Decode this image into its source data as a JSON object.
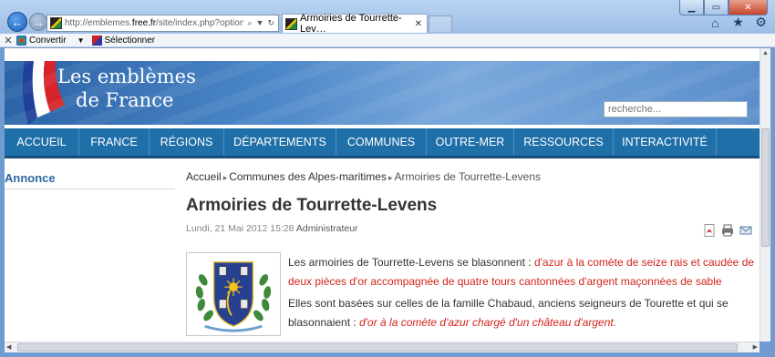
{
  "browser": {
    "address_url_prefix": "http://emblemes.",
    "address_url_domain": "free.fr",
    "address_url_rest": "/site/index.php?option=com_conten",
    "tab_title": "Armoiries de Tourrette-Lev…",
    "tab_close": "✕",
    "command_bar": {
      "close": "✕",
      "convert_label": "Convertir",
      "select_label": "Sélectionner"
    }
  },
  "site": {
    "title_line1": "Les emblèmes",
    "title_line2": "de France",
    "search_placeholder": "recherche...",
    "nav": [
      {
        "label": "ACCUEIL"
      },
      {
        "label": "FRANCE"
      },
      {
        "label": "RÉGIONS"
      },
      {
        "label": "DÉPARTEMENTS"
      },
      {
        "label": "COMMUNES"
      },
      {
        "label": "OUTRE-MER"
      },
      {
        "label": "RESSOURCES"
      },
      {
        "label": "INTERACTIVITÉ"
      }
    ],
    "sidebar_heading": "Annonce"
  },
  "article": {
    "breadcrumb": [
      "Accueil",
      "Communes des Alpes-maritimes",
      "Armoiries de Tourrette-Levens"
    ],
    "title": "Armoiries de Tourrette-Levens",
    "date": "Lundi, 21 Mai 2012 15:28",
    "author": "Administrateur",
    "p1_plain": "Les armoiries de Tourrette-Levens se blasonnent : ",
    "p1_red": "d'azur à la comète de seize rais et caudée de deux pièces d'or accompagnée de quatre tours cantonnées d'argent maçonnées de sable",
    "p2_plain": "Elles sont basées sur celles de la famille Chabaud, anciens seigneurs de Tourette et qui se blasonnaient : ",
    "p2_red": "d'or à la comète d'azur chargé d'un château d'argent."
  },
  "colors": {
    "nav_bg": "#1f6fa9",
    "accent_blue": "#2b6aa3",
    "blazon_red": "#d2241c"
  }
}
